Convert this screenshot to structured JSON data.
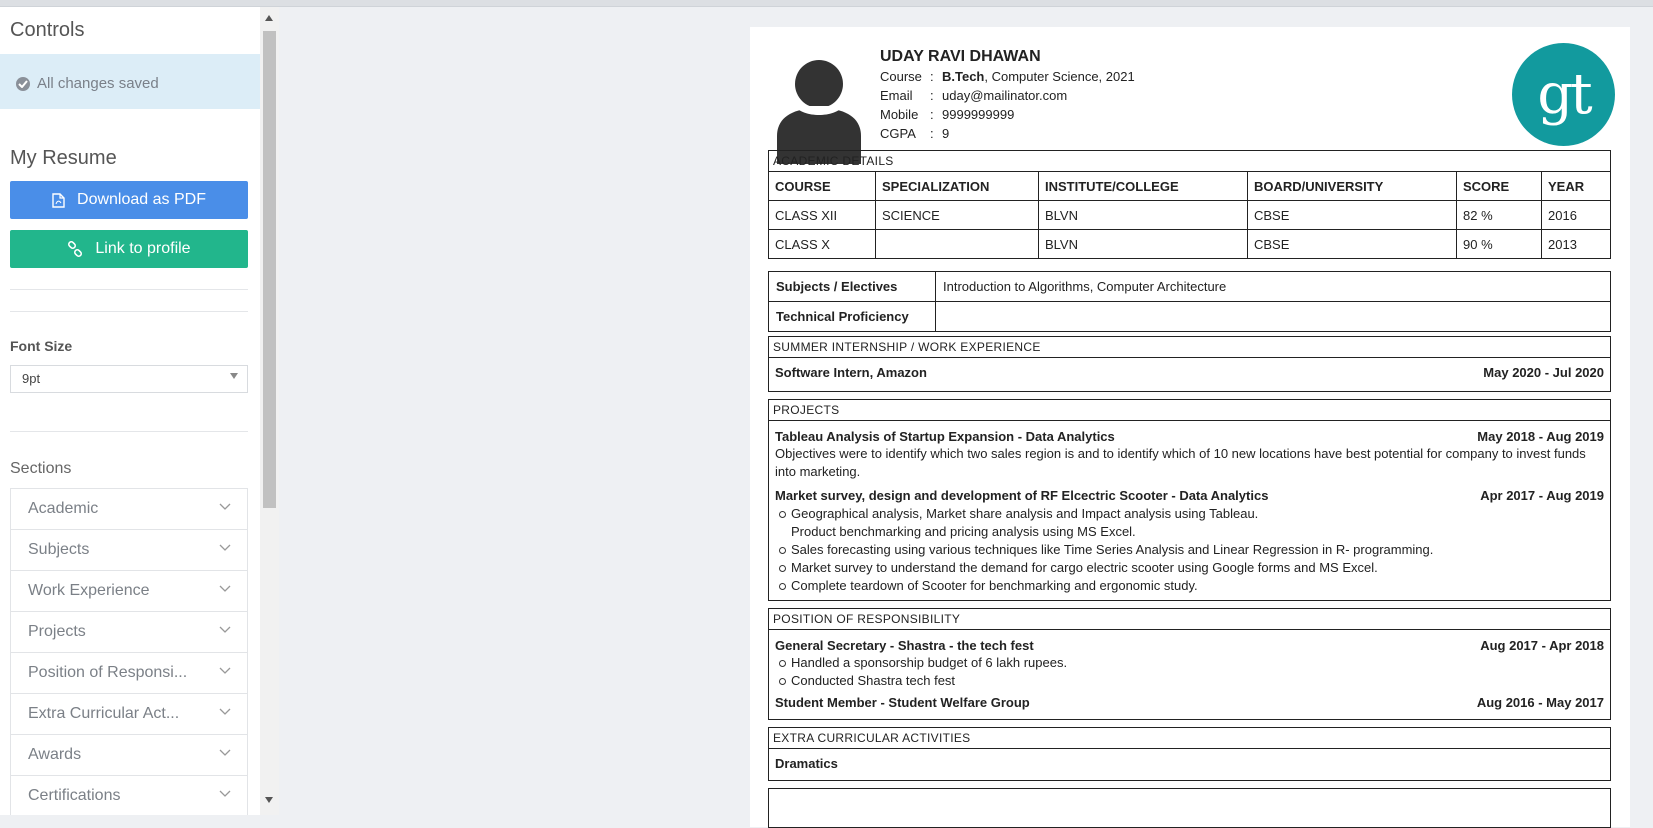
{
  "sidebar": {
    "controls_title": "Controls",
    "saved_text": "All changes saved",
    "my_resume_title": "My Resume",
    "download_label": "Download as PDF",
    "link_label": "Link to profile",
    "font_size_label": "Font Size",
    "font_size_value": "9pt",
    "sections_label": "Sections",
    "sections": [
      {
        "label": "Academic"
      },
      {
        "label": "Subjects"
      },
      {
        "label": "Work Experience"
      },
      {
        "label": "Projects"
      },
      {
        "label": "Position of Responsi..."
      },
      {
        "label": "Extra Curricular Act..."
      },
      {
        "label": "Awards"
      },
      {
        "label": "Certifications"
      }
    ]
  },
  "resume": {
    "name": "UDAY RAVI DHAWAN",
    "course_label": "Course",
    "course_degree": "B.Tech",
    "course_rest": ", Computer Science, 2021",
    "email_label": "Email",
    "email": "uday@mailinator.com",
    "mobile_label": "Mobile",
    "mobile": "9999999999",
    "cgpa_label": "CGPA",
    "cgpa": "9",
    "logo_text": "gt",
    "academic": {
      "title": "ACADEMIC DETAILS",
      "headers": [
        "COURSE",
        "SPECIALIZATION",
        "INSTITUTE/COLLEGE",
        "BOARD/UNIVERSITY",
        "SCORE",
        "YEAR"
      ],
      "rows": [
        [
          "CLASS XII",
          "SCIENCE",
          "BLVN",
          "CBSE",
          "82 %",
          "2016"
        ],
        [
          "CLASS X",
          "",
          "BLVN",
          "CBSE",
          "90 %",
          "2013"
        ]
      ]
    },
    "subjects": {
      "electives_label": "Subjects / Electives",
      "electives_value": "Introduction to Algorithms,  Computer Architecture",
      "technical_label": "Technical Proficiency",
      "technical_value": ""
    },
    "work": {
      "title": "SUMMER INTERNSHIP / WORK EXPERIENCE",
      "role": "Software Intern, Amazon",
      "dates": "May 2020 - Jul 2020"
    },
    "projects": {
      "title": "PROJECTS",
      "p1_title": "Tableau Analysis of Startup Expansion - Data Analytics",
      "p1_dates": "May 2018 - Aug 2019",
      "p1_desc": "Objectives were to identify which two sales region is and to identify which of 10 new locations have best potential for company to invest funds into marketing.",
      "p2_title": "Market survey, design and development of RF Elcectric Scooter - Data Analytics",
      "p2_dates": "Apr 2017 - Aug 2019",
      "p2_b1a": "Geographical analysis, Market share analysis and Impact analysis using Tableau.",
      "p2_b1b": "Product benchmarking and pricing analysis using MS Excel.",
      "p2_b2": "Sales forecasting using various techniques like Time Series Analysis and Linear Regression in R- programming.",
      "p2_b3": "Market survey to understand the demand for cargo electric scooter using Google forms and MS Excel.",
      "p2_b4": "Complete teardown of Scooter for benchmarking and ergonomic study."
    },
    "por": {
      "title": "POSITION OF RESPONSIBILITY",
      "r1_title": "General Secretary - Shastra - the tech fest",
      "r1_dates": "Aug 2017 - Apr 2018",
      "r1_b1": "Handled a sponsorship budget of 6 lakh rupees.",
      "r1_b2": "Conducted Shastra tech fest",
      "r2_title": "Student Member - Student Welfare Group",
      "r2_dates": "Aug 2016 - May 2017"
    },
    "extra": {
      "title": "EXTRA CURRICULAR ACTIVITIES",
      "a1": "Dramatics"
    }
  }
}
